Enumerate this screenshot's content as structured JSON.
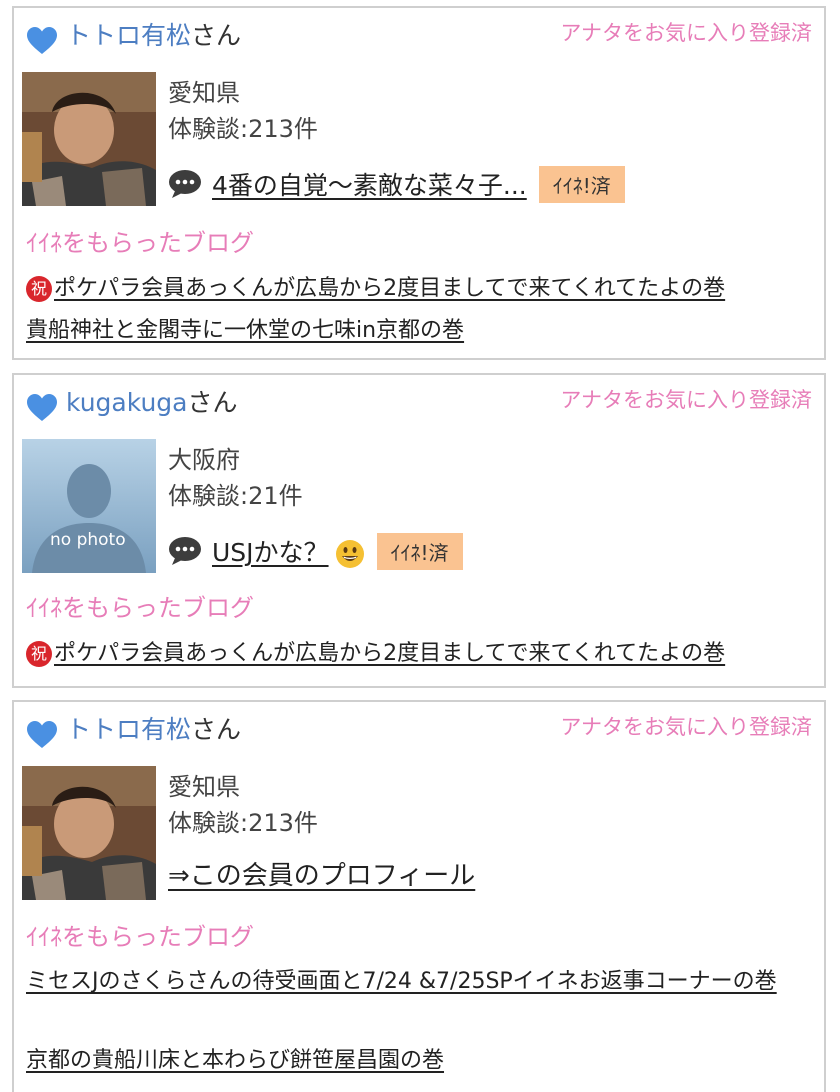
{
  "colors": {
    "username": "#4d7ec2",
    "pink": "#e77db8",
    "liked_tag_bg": "#fac391",
    "border": "#cfcfcf",
    "celebrate": "#d9262c"
  },
  "cards": [
    {
      "username": "トトロ有松",
      "suffix": "さん",
      "fav_status": "アナタをお気に入り登録済",
      "avatar": "user-photo",
      "prefecture": "愛知県",
      "reports": "体験談:213件",
      "blog_icon": "speech-bubble-icon",
      "blog_title": "4番の自覚〜素敵な菜々子...",
      "liked_tag": "ｲｲﾈ!済",
      "received_heading": "ｲｲﾈをもらったブログ",
      "received_blogs": [
        {
          "badge": "祝",
          "title": "ポケパラ会員あっくんが広島から2度目ましてで来てくれてたよの巻"
        },
        {
          "title": "貴船神社と金閣寺に一休堂の七味in京都の巻"
        }
      ]
    },
    {
      "username": "kugakuga",
      "suffix": "さん",
      "fav_status": "アナタをお気に入り登録済",
      "avatar": "no photo",
      "prefecture": "大阪府",
      "reports": "体験談:21件",
      "blog_icon": "speech-bubble-icon",
      "blog_title": "USJかな？",
      "liked_tag": "ｲｲﾈ!済",
      "received_heading": "ｲｲﾈをもらったブログ",
      "received_blogs": [
        {
          "badge": "祝",
          "title": "ポケパラ会員あっくんが広島から2度目ましてで来てくれてたよの巻"
        }
      ]
    },
    {
      "username": "トトロ有松",
      "suffix": "さん",
      "fav_status": "アナタをお気に入り登録済",
      "avatar": "user-photo",
      "prefecture": "愛知県",
      "reports": "体験談:213件",
      "profile_link": "⇒この会員のプロフィール",
      "received_heading": "ｲｲﾈをもらったブログ",
      "received_blogs": [
        {
          "title": "ミセスJのさくらさんの待受画面と7/24 &7/25SPイイネお返事コーナーの巻"
        },
        {
          "title": "京都の貴船川床と本わらび餅笹屋昌園の巻"
        }
      ]
    }
  ]
}
